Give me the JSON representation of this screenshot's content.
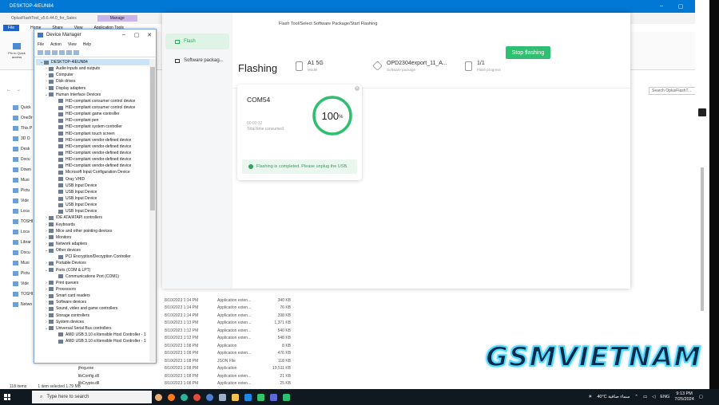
{
  "remote_desktop": {
    "title": "DESKTOP-4IEUN84",
    "controls": [
      "–",
      "▢",
      "✕"
    ]
  },
  "explorer": {
    "title": "OplusFlashTool_v5.6.44.0_for_Sales",
    "manage_tab": "Manage",
    "ribbon": {
      "file": "File",
      "home": "Home",
      "share": "Share",
      "view": "View",
      "app_tools": "Application Tools"
    },
    "pin_quick_access": "Pin to Quick access",
    "search_placeholder": "Search OplusFlashT...",
    "nav": [
      "Quick",
      "OneDr",
      "This P",
      "3D O",
      "Desk",
      "Docu",
      "Down",
      "Musi",
      "Pictu",
      "Vide",
      "Loca",
      "TOSHI",
      "Loca",
      "Librar",
      "Docu",
      "Musi",
      "Pictu",
      "Vide",
      "TOSHI",
      "Netwo"
    ],
    "status": {
      "items": "118 items",
      "selected": "1 item selected  1.79 MB"
    },
    "files": [
      {
        "name": "",
        "date": "8/10/2023 1:14 PM",
        "type": "Application exten...",
        "size": "340 KB"
      },
      {
        "name": "",
        "date": "8/10/2023 1:14 PM",
        "type": "Application exten...",
        "size": "76 KB"
      },
      {
        "name": "",
        "date": "8/10/2023 1:14 PM",
        "type": "Application exten...",
        "size": "398 KB"
      },
      {
        "name": "",
        "date": "8/10/2023 1:13 PM",
        "type": "Application exten...",
        "size": "1,371 KB"
      },
      {
        "name": "",
        "date": "8/10/2023 1:12 PM",
        "type": "Application exten...",
        "size": "540 KB"
      },
      {
        "name": "",
        "date": "8/10/2023 1:12 PM",
        "type": "Application exten...",
        "size": "548 KB"
      },
      {
        "name": "",
        "date": "8/10/2023 1:08 PM",
        "type": "Application",
        "size": "8 KB"
      },
      {
        "name": "",
        "date": "8/10/2023 1:08 PM",
        "type": "Application exten...",
        "size": "476 KB"
      },
      {
        "name": "",
        "date": "8/10/2023 1:08 PM",
        "type": "JSON File",
        "size": "118 KB"
      },
      {
        "name": "jfrog.exe",
        "date": "8/10/2023 1:08 PM",
        "type": "Application",
        "size": "19,511 KB"
      },
      {
        "name": "libConfig.dll",
        "date": "8/10/2023 1:08 PM",
        "type": "Application exten...",
        "size": "21 KB"
      },
      {
        "name": "libCrypto.dll",
        "date": "8/10/2023 1:08 PM",
        "type": "Application exten...",
        "size": "25 KB"
      }
    ]
  },
  "device_manager": {
    "title": "Device Manager",
    "menu": [
      "File",
      "Action",
      "View",
      "Help"
    ],
    "tree": [
      {
        "label": "DESKTOP-4IEUN84",
        "level": 0,
        "toggle": "v",
        "selected": true
      },
      {
        "label": "Audio inputs and outputs",
        "level": 1,
        "toggle": ">"
      },
      {
        "label": "Computer",
        "level": 1,
        "toggle": ">"
      },
      {
        "label": "Disk drives",
        "level": 1,
        "toggle": ">"
      },
      {
        "label": "Display adapters",
        "level": 1,
        "toggle": ">"
      },
      {
        "label": "Human Interface Devices",
        "level": 1,
        "toggle": "v"
      },
      {
        "label": "HID-compliant consumer control device",
        "level": 2
      },
      {
        "label": "HID-compliant consumer control device",
        "level": 2
      },
      {
        "label": "HID-compliant game controller",
        "level": 2
      },
      {
        "label": "HID-compliant pen",
        "level": 2
      },
      {
        "label": "HID-compliant system controller",
        "level": 2
      },
      {
        "label": "HID-compliant touch screen",
        "level": 2
      },
      {
        "label": "HID-compliant vendor-defined device",
        "level": 2
      },
      {
        "label": "HID-compliant vendor-defined device",
        "level": 2
      },
      {
        "label": "HID-compliant vendor-defined device",
        "level": 2
      },
      {
        "label": "HID-compliant vendor-defined device",
        "level": 2
      },
      {
        "label": "HID-compliant vendor-defined device",
        "level": 2
      },
      {
        "label": "Microsoft Input Configuration Device",
        "level": 2
      },
      {
        "label": "Oray VHID",
        "level": 2
      },
      {
        "label": "USB Input Device",
        "level": 2
      },
      {
        "label": "USB Input Device",
        "level": 2
      },
      {
        "label": "USB Input Device",
        "level": 2
      },
      {
        "label": "USB Input Device",
        "level": 2
      },
      {
        "label": "USB Input Device",
        "level": 2
      },
      {
        "label": "IDE ATA/ATAPI controllers",
        "level": 1,
        "toggle": ">"
      },
      {
        "label": "Keyboards",
        "level": 1,
        "toggle": ">"
      },
      {
        "label": "Mice and other pointing devices",
        "level": 1,
        "toggle": ">"
      },
      {
        "label": "Monitors",
        "level": 1,
        "toggle": ">"
      },
      {
        "label": "Network adapters",
        "level": 1,
        "toggle": ">"
      },
      {
        "label": "Other devices",
        "level": 1,
        "toggle": "v"
      },
      {
        "label": "PCI Encryption/Decryption Controller",
        "level": 2
      },
      {
        "label": "Portable Devices",
        "level": 1,
        "toggle": ">"
      },
      {
        "label": "Ports (COM & LPT)",
        "level": 1,
        "toggle": "v"
      },
      {
        "label": "Communications Port (COM1)",
        "level": 2
      },
      {
        "label": "Print queues",
        "level": 1,
        "toggle": ">"
      },
      {
        "label": "Processors",
        "level": 1,
        "toggle": ">"
      },
      {
        "label": "Smart card readers",
        "level": 1,
        "toggle": ">"
      },
      {
        "label": "Software devices",
        "level": 1,
        "toggle": ">"
      },
      {
        "label": "Sound, video and game controllers",
        "level": 1,
        "toggle": ">"
      },
      {
        "label": "Storage controllers",
        "level": 1,
        "toggle": ">"
      },
      {
        "label": "System devices",
        "level": 1,
        "toggle": ">"
      },
      {
        "label": "Universal Serial Bus controllers",
        "level": 1,
        "toggle": "v"
      },
      {
        "label": "AMD USB 3.10 eXtensible Host Controller - 1",
        "level": 2
      },
      {
        "label": "AMD USB 3.10 eXtensible Host Controller - 1",
        "level": 2
      }
    ]
  },
  "flash_tool": {
    "breadcrumb": "Flash Tool/Select Software Package/Start Flashing",
    "sidebar": [
      {
        "label": "Flash",
        "active": true
      },
      {
        "label": "Software packag...",
        "active": false
      }
    ],
    "heading": "Flashing",
    "model": {
      "value": "A1 5G",
      "label": "Model"
    },
    "package": {
      "value": "OPD2304export_11_A...",
      "label": "Software package"
    },
    "progress": {
      "value": "1/1",
      "label": "Flash progress"
    },
    "stop_button": "Stop flashing",
    "card": {
      "port": "COM54",
      "percent_number": "100",
      "percent_sign": "%",
      "percent": 100,
      "time": "00:03:32",
      "time_label": "Total time consumed",
      "message": "Flashing is completed. Please unplug the USB."
    },
    "accent_color": "#2fbf71"
  },
  "watermark": "GSMVIETNAM",
  "taskbar": {
    "search_placeholder": "Type here to search",
    "weather": "40°C  سماء صافية",
    "language": "ENG",
    "time": "9:13 PM",
    "date": "7/25/2024"
  }
}
